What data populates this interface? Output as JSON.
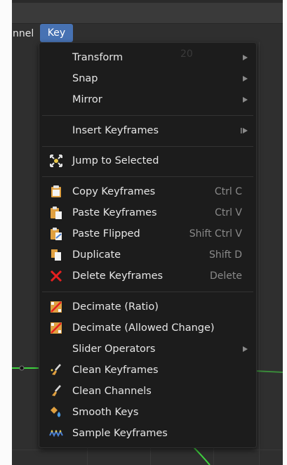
{
  "menubar": {
    "channel_label": "nnel",
    "key_label": "Key"
  },
  "menu": {
    "faded_value": "20",
    "items": [
      {
        "label": "Transform",
        "shortcut": "",
        "submenu": true
      },
      {
        "label": "Snap",
        "shortcut": "",
        "submenu": true
      },
      {
        "label": "Mirror",
        "shortcut": "",
        "submenu": true
      },
      {
        "label": "Insert Keyframes",
        "shortcut": "",
        "submenu": "operator"
      },
      {
        "label": "Jump to Selected",
        "shortcut": ""
      },
      {
        "label": "Copy Keyframes",
        "shortcut": "Ctrl C"
      },
      {
        "label": "Paste Keyframes",
        "shortcut": "Ctrl V"
      },
      {
        "label": "Paste Flipped",
        "shortcut": "Shift Ctrl V"
      },
      {
        "label": "Duplicate",
        "shortcut": "Shift D"
      },
      {
        "label": "Delete Keyframes",
        "shortcut": "Delete"
      },
      {
        "label": "Decimate (Ratio)",
        "shortcut": ""
      },
      {
        "label": "Decimate (Allowed Change)",
        "shortcut": ""
      },
      {
        "label": "Slider Operators",
        "shortcut": "",
        "submenu": true
      },
      {
        "label": "Clean Keyframes",
        "shortcut": ""
      },
      {
        "label": "Clean Channels",
        "shortcut": ""
      },
      {
        "label": "Smooth Keys",
        "shortcut": ""
      },
      {
        "label": "Sample Keyframes",
        "shortcut": ""
      }
    ]
  },
  "colors": {
    "accent": "#4772b3",
    "menu_bg": "#1c1c1c",
    "curve_green": "#3fd23f",
    "delete_red": "#e62020"
  },
  "icons": {
    "jump": "jump-to-selected-icon",
    "copy": "copy-icon",
    "paste": "paste-icon",
    "paste_flipped": "paste-flipped-icon",
    "duplicate": "duplicate-icon",
    "delete": "delete-x-icon",
    "decimate": "decimate-icon",
    "clean": "brush-icon",
    "smooth": "smooth-icon",
    "sample": "sample-icon"
  }
}
